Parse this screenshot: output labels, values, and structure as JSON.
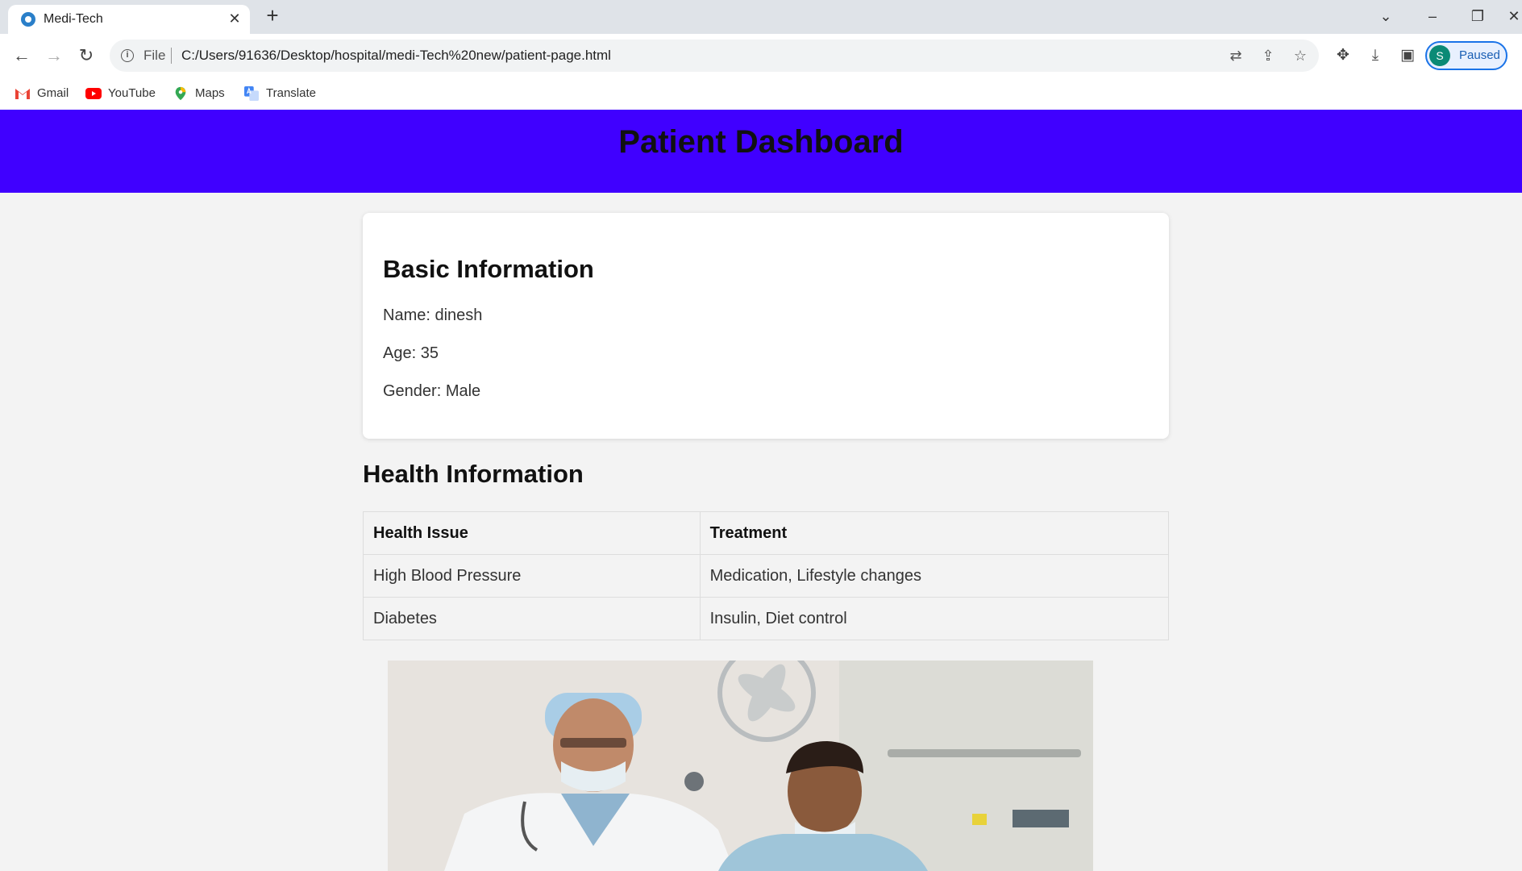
{
  "browser": {
    "tab": {
      "title": "Medi-Tech"
    },
    "address": {
      "scheme_label": "File",
      "url": "C:/Users/91636/Desktop/hospital/medi-Tech%20new/patient-page.html"
    },
    "profile": {
      "initial": "S",
      "status": "Paused"
    },
    "bookmarks": [
      {
        "label": "Gmail",
        "icon": "gmail-icon"
      },
      {
        "label": "YouTube",
        "icon": "youtube-icon"
      },
      {
        "label": "Maps",
        "icon": "maps-icon"
      },
      {
        "label": "Translate",
        "icon": "translate-icon"
      }
    ]
  },
  "header": {
    "title": "Patient Dashboard"
  },
  "basic_info": {
    "heading": "Basic Information",
    "name": "Name: dinesh",
    "age": "Age: 35",
    "gender": "Gender: Male"
  },
  "health_info": {
    "heading": "Health Information",
    "columns": [
      "Health Issue",
      "Treatment"
    ],
    "rows": [
      [
        "High Blood Pressure",
        "Medication, Lifestyle changes"
      ],
      [
        "Diabetes",
        "Insulin, Diet control"
      ]
    ]
  },
  "colors": {
    "header_bg": "#4000ff",
    "page_bg": "#f3f3f3"
  }
}
